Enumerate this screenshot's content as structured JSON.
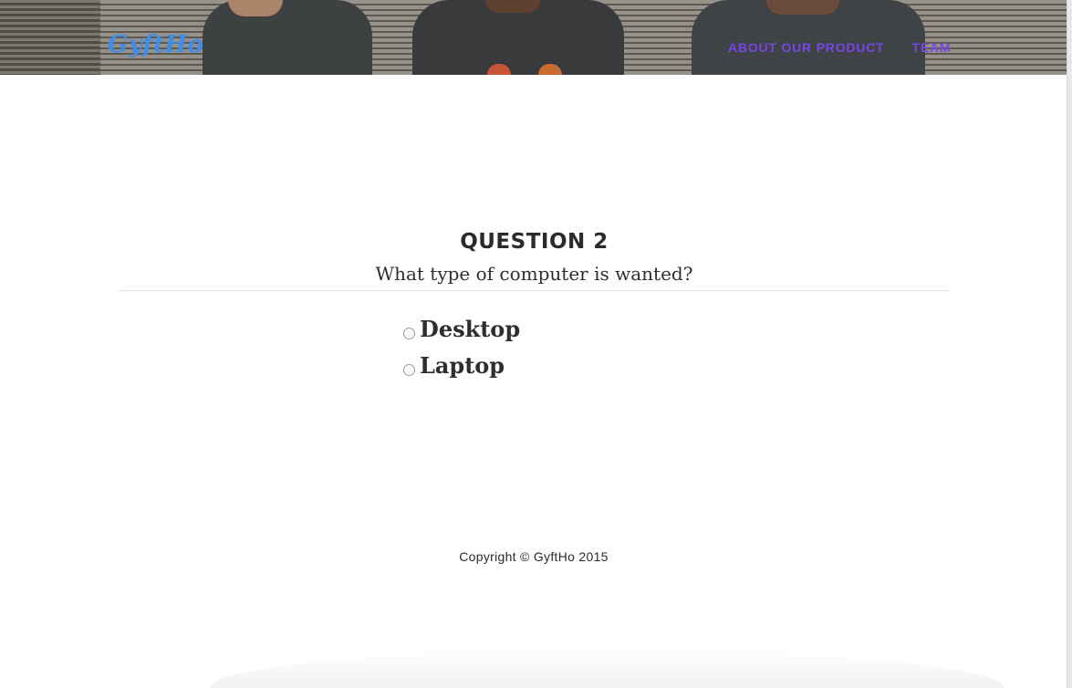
{
  "header": {
    "brand": "GyftHo",
    "nav": [
      {
        "label": "ABOUT OUR PRODUCT"
      },
      {
        "label": "TEAM"
      }
    ]
  },
  "question": {
    "title": "QUESTION 2",
    "text": "What type of computer is wanted?",
    "options": [
      {
        "label": "Desktop",
        "selected": false
      },
      {
        "label": "Laptop",
        "selected": false
      }
    ]
  },
  "footer": {
    "copyright": "Copyright © GyftHo 2015"
  },
  "colors": {
    "brand": "#3d8eea",
    "nav_link": "#7a45e6",
    "text": "#2b2b2b"
  },
  "icons": {
    "option_radio": "radio-icon"
  }
}
